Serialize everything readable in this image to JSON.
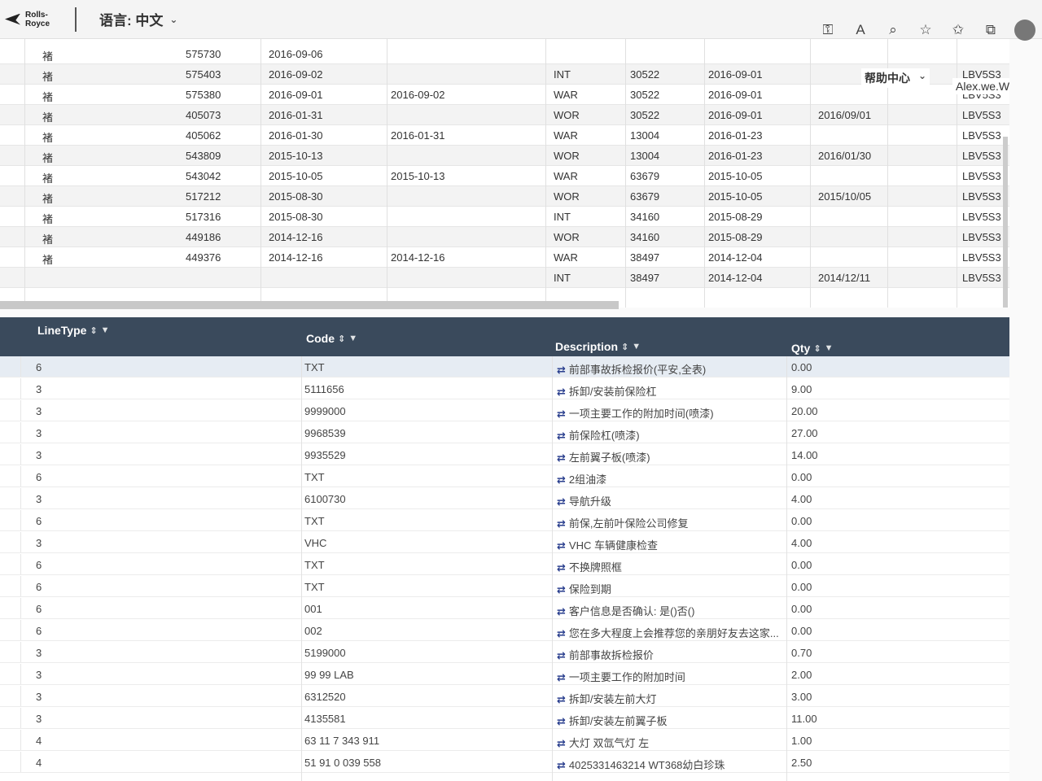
{
  "topbar": {
    "logo_text": "Rolls-Royce",
    "language_label": "语言: 中文",
    "icons": [
      "key-icon",
      "read-aloud-icon",
      "zoom-icon",
      "favorite-add-icon",
      "favorites-icon",
      "collections-icon",
      "profile-avatar"
    ]
  },
  "header": {
    "help_label": "帮助中心",
    "user_name": "Alex.we.Wang"
  },
  "upper_grid": {
    "rows": [
      {
        "flag": "褚",
        "id": "575730",
        "date1": "2016-09-06",
        "date2": "",
        "type": "",
        "code": "",
        "date3": "",
        "date4": "",
        "vin": ""
      },
      {
        "flag": "褚",
        "id": "575403",
        "date1": "2016-09-02",
        "date2": "",
        "type": "INT",
        "code": "30522",
        "date3": "2016-09-01",
        "date4": "",
        "vin": "LBV5S3"
      },
      {
        "flag": "褚",
        "id": "575380",
        "date1": "2016-09-01",
        "date2": "2016-09-02",
        "type": "WAR",
        "code": "30522",
        "date3": "2016-09-01",
        "date4": "",
        "vin": "LBV5S3"
      },
      {
        "flag": "褚",
        "id": "405073",
        "date1": "2016-01-31",
        "date2": "",
        "type": "WOR",
        "code": "30522",
        "date3": "2016-09-01",
        "date4": "2016/09/01",
        "vin": "LBV5S3"
      },
      {
        "flag": "褚",
        "id": "405062",
        "date1": "2016-01-30",
        "date2": "2016-01-31",
        "type": "WAR",
        "code": "13004",
        "date3": "2016-01-23",
        "date4": "",
        "vin": "LBV5S3"
      },
      {
        "flag": "褚",
        "id": "543809",
        "date1": "2015-10-13",
        "date2": "",
        "type": "WOR",
        "code": "13004",
        "date3": "2016-01-23",
        "date4": "2016/01/30",
        "vin": "LBV5S3"
      },
      {
        "flag": "褚",
        "id": "543042",
        "date1": "2015-10-05",
        "date2": "2015-10-13",
        "type": "WAR",
        "code": "63679",
        "date3": "2015-10-05",
        "date4": "",
        "vin": "LBV5S3"
      },
      {
        "flag": "褚",
        "id": "517212",
        "date1": "2015-08-30",
        "date2": "",
        "type": "WOR",
        "code": "63679",
        "date3": "2015-10-05",
        "date4": "2015/10/05",
        "vin": "LBV5S3"
      },
      {
        "flag": "褚",
        "id": "517316",
        "date1": "2015-08-30",
        "date2": "",
        "type": "INT",
        "code": "34160",
        "date3": "2015-08-29",
        "date4": "",
        "vin": "LBV5S3"
      },
      {
        "flag": "褚",
        "id": "449186",
        "date1": "2014-12-16",
        "date2": "",
        "type": "WOR",
        "code": "34160",
        "date3": "2015-08-29",
        "date4": "",
        "vin": "LBV5S3"
      },
      {
        "flag": "褚",
        "id": "449376",
        "date1": "2014-12-16",
        "date2": "2014-12-16",
        "type": "WAR",
        "code": "38497",
        "date3": "2014-12-04",
        "date4": "",
        "vin": "LBV5S3"
      },
      {
        "flag": "",
        "id": "",
        "date1": "",
        "date2": "",
        "type": "INT",
        "code": "38497",
        "date3": "2014-12-04",
        "date4": "2014/12/11",
        "vin": "LBV5S3"
      }
    ]
  },
  "lower_grid": {
    "columns": {
      "linetype": "LineType",
      "code": "Code",
      "description": "Description",
      "qty": "Qty"
    },
    "swap_glyph": "⇄",
    "rows": [
      {
        "linetype": "6",
        "code": "TXT",
        "description": "前部事故拆检报价(平安,全表)",
        "qty": "0.00"
      },
      {
        "linetype": "3",
        "code": "5111656",
        "description": "拆卸/安装前保险杠",
        "qty": "9.00"
      },
      {
        "linetype": "3",
        "code": "9999000",
        "description": "一项主要工作的附加时间(喷漆)",
        "qty": "20.00"
      },
      {
        "linetype": "3",
        "code": "9968539",
        "description": "前保险杠(喷漆)",
        "qty": "27.00"
      },
      {
        "linetype": "3",
        "code": "9935529",
        "description": "左前翼子板(喷漆)",
        "qty": "14.00"
      },
      {
        "linetype": "6",
        "code": "TXT",
        "description": "2组油漆",
        "qty": "0.00"
      },
      {
        "linetype": "3",
        "code": "6100730",
        "description": "导航升级",
        "qty": "4.00"
      },
      {
        "linetype": "6",
        "code": "TXT",
        "description": "前保,左前叶保险公司修复",
        "qty": "0.00"
      },
      {
        "linetype": "3",
        "code": "VHC",
        "description": "VHC 车辆健康检查",
        "qty": "4.00"
      },
      {
        "linetype": "6",
        "code": "TXT",
        "description": "不换牌照框",
        "qty": "0.00"
      },
      {
        "linetype": "6",
        "code": "TXT",
        "description": "保险到期",
        "qty": "0.00"
      },
      {
        "linetype": "6",
        "code": "001",
        "description": "客户信息是否确认: 是()否()",
        "qty": "0.00"
      },
      {
        "linetype": "6",
        "code": "002",
        "description": "您在多大程度上会推荐您的亲朋好友去这家...",
        "qty": "0.00"
      },
      {
        "linetype": "3",
        "code": "5199000",
        "description": "前部事故拆检报价",
        "qty": "0.70"
      },
      {
        "linetype": "3",
        "code": "99 99 LAB",
        "description": "一项主要工作的附加时间",
        "qty": "2.00"
      },
      {
        "linetype": "3",
        "code": "6312520",
        "description": "拆卸/安装左前大灯",
        "qty": "3.00"
      },
      {
        "linetype": "3",
        "code": "4135581",
        "description": "拆卸/安装左前翼子板",
        "qty": "11.00"
      },
      {
        "linetype": "4",
        "code": "63 11 7 343 911",
        "description": "大灯 双氙气灯 左",
        "qty": "1.00"
      },
      {
        "linetype": "4",
        "code": "51 91 0 039 558",
        "description": "4025331463214 WT368幼白珍珠",
        "qty": "2.50"
      }
    ]
  }
}
